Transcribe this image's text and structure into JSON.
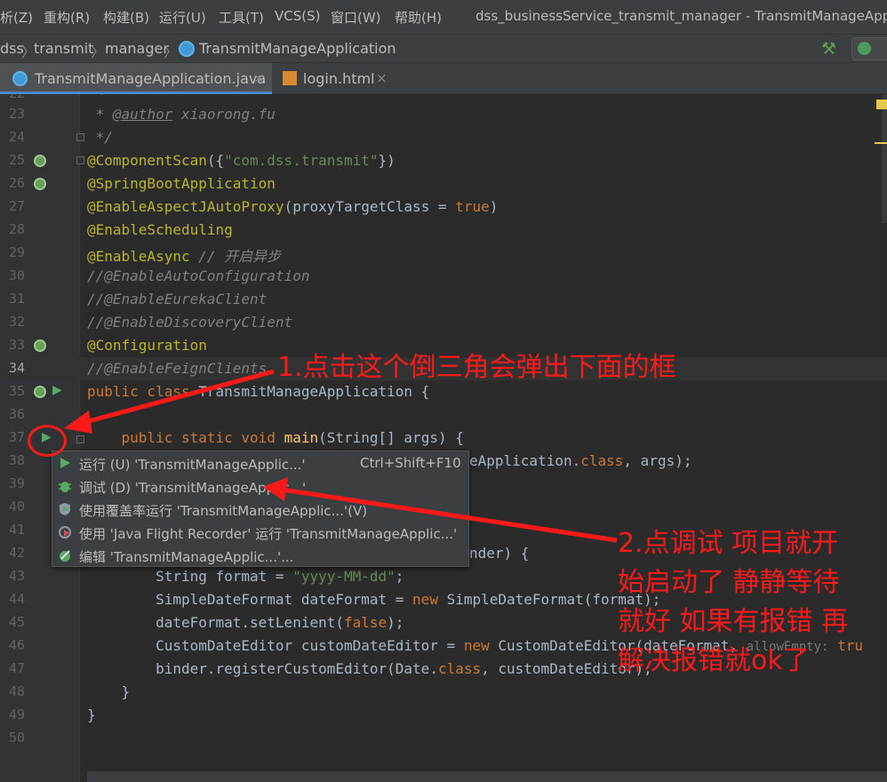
{
  "menubar": {
    "items": [
      {
        "label": "析(Z)"
      },
      {
        "label": "重构(R)"
      },
      {
        "label": "构建(B)"
      },
      {
        "label": "运行(U)"
      },
      {
        "label": "工具(T)"
      },
      {
        "label": "VCS(S)"
      },
      {
        "label": "窗口(W)"
      },
      {
        "label": "帮助(H)"
      }
    ],
    "window_title": "dss_businessService_transmit_manager - TransmitManageApplic"
  },
  "breadcrumb": {
    "items": [
      "dss",
      "transmit",
      "manager",
      "TransmitManageApplication"
    ]
  },
  "tabs": [
    {
      "label": "TransmitManageApplication.java",
      "close": "×"
    },
    {
      "label": "login.html",
      "close": "×"
    }
  ],
  "editor": {
    "first_partial_line": "22",
    "lines": [
      {
        "num": "23"
      },
      {
        "num": "24"
      },
      {
        "num": "25"
      },
      {
        "num": "26"
      },
      {
        "num": "27"
      },
      {
        "num": "28"
      },
      {
        "num": "29"
      },
      {
        "num": "30"
      },
      {
        "num": "31"
      },
      {
        "num": "32"
      },
      {
        "num": "33"
      },
      {
        "num": "34"
      },
      {
        "num": "35"
      },
      {
        "num": "36"
      },
      {
        "num": "37"
      },
      {
        "num": "38"
      },
      {
        "num": "39"
      },
      {
        "num": "40"
      },
      {
        "num": "41"
      },
      {
        "num": "42"
      },
      {
        "num": "43"
      },
      {
        "num": "44"
      },
      {
        "num": "45"
      },
      {
        "num": "46"
      },
      {
        "num": "47"
      },
      {
        "num": "48"
      },
      {
        "num": "49"
      },
      {
        "num": "50"
      }
    ],
    "code": {
      "l22": "*",
      "l23_a": " * ",
      "l23_b": "@author",
      "l23_c": " xiaorong.fu",
      "l24": " */",
      "l25_a": "@ComponentScan",
      "l25_b": "({",
      "l25_c": "\"com.dss.transmit\"",
      "l25_d": "})",
      "l26": "@SpringBootApplication",
      "l27_a": "@EnableAspectJAutoProxy",
      "l27_b": "(proxyTargetClass = ",
      "l27_c": "true",
      "l27_d": ")",
      "l28": "@EnableScheduling",
      "l29_a": "@EnableAsync",
      "l29_b": " // 开启异步",
      "l30": "//@EnableAutoConfiguration",
      "l31": "//@EnableEurekaClient",
      "l32": "//@EnableDiscoveryClient",
      "l33": "@Configuration",
      "l34": "//@EnableFeignClients",
      "l35_a": "public class",
      "l35_b": " TransmitManageApplication {",
      "l37_a": "    public static void ",
      "l37_b": "main",
      "l37_c": "(String[] args) {",
      "l38_a": "eApplication.",
      "l38_b": "class",
      "l38_c": ", args);",
      "l42": "nder) {",
      "l43_a": "        String format = ",
      "l43_b": "\"yyyy-MM-dd\"",
      "l43_c": ";",
      "l44_a": "        SimpleDateFormat dateFormat = ",
      "l44_b": "new",
      "l44_c": " SimpleDateFormat(format);",
      "l45_a": "        dateFormat.setLenient(",
      "l45_b": "false",
      "l45_c": ");",
      "l46_a": "        CustomDateEditor customDateEditor = ",
      "l46_b": "new",
      "l46_c": " CustomDateEditor(dateFormat, ",
      "l46_d": "allowEmpty:",
      "l46_e": " tru",
      "l47_a": "        binder.registerCustomEditor(Date.",
      "l47_b": "class",
      "l47_c": ", customDateEditor);",
      "l48": "    }",
      "l49": "}"
    }
  },
  "popup": {
    "items": [
      {
        "label": "运行 (U) 'TransmitManageApplic...'",
        "shortcut": "Ctrl+Shift+F10"
      },
      {
        "label": "调试 (D) 'TransmitManageApplic...'"
      },
      {
        "label": "使用覆盖率运行  'TransmitManageApplic...'(V)"
      },
      {
        "label": "使用 'Java Flight Recorder' 运行 'TransmitManageApplic...'"
      },
      {
        "label": "编辑 'TransmitManageApplic...'..."
      }
    ]
  },
  "annotations": {
    "note1": "1.点击这个倒三角会弹出下面的框",
    "note2_lines": [
      "2.点调试 项目就开",
      "始启动了 静静等待",
      "就好 如果有报错 再",
      "解决报错就ok了"
    ]
  },
  "colors": {
    "background": "#2b2b2b",
    "annotation": "#ff1a1a",
    "annotation_color": "#bbb529",
    "keyword": "#cc7832",
    "string": "#6a8759"
  }
}
